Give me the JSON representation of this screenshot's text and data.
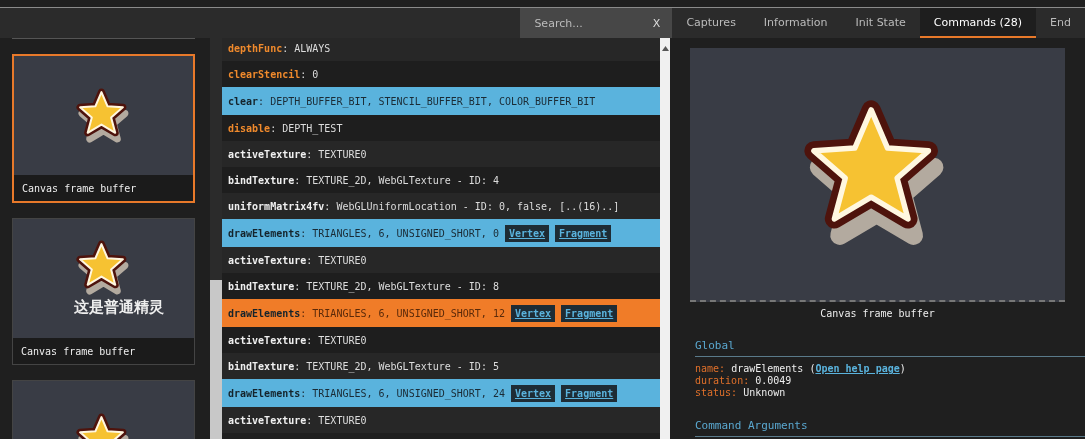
{
  "search": {
    "placeholder": "Search...",
    "clear_label": "X"
  },
  "tabs": [
    {
      "label": "Captures",
      "selected": false
    },
    {
      "label": "Information",
      "selected": false
    },
    {
      "label": "Init State",
      "selected": false
    },
    {
      "label": "Commands (28)",
      "selected": true
    },
    {
      "label": "End",
      "selected": false
    }
  ],
  "thumbnails": [
    {
      "caption": "Canvas frame buffer",
      "selected": true
    },
    {
      "caption": "Canvas frame buffer",
      "overlay_text": "这是普通精灵",
      "selected": false
    },
    {
      "selected": false
    }
  ],
  "commands": [
    {
      "name": "depthFunc",
      "sep": ": ",
      "args": "ALWAYS",
      "kind": "state",
      "selected": false
    },
    {
      "name": "clearStencil",
      "sep": ": ",
      "args": "0",
      "kind": "state",
      "selected": false
    },
    {
      "name": "clear",
      "sep": ": ",
      "args": "DEPTH_BUFFER_BIT, STENCIL_BUFFER_BIT, COLOR_BUFFER_BIT",
      "kind": "draw",
      "selected": false
    },
    {
      "name": "disable",
      "sep": ": ",
      "args": "DEPTH_TEST",
      "kind": "state",
      "selected": false
    },
    {
      "name": "activeTexture",
      "sep": ": ",
      "args": "TEXTURE0",
      "kind": "call",
      "selected": false
    },
    {
      "name": "bindTexture",
      "sep": ": ",
      "args": "TEXTURE_2D, WebGLTexture - ID: 4",
      "kind": "call",
      "selected": false
    },
    {
      "name": "uniformMatrix4fv",
      "sep": ": ",
      "args": "WebGLUniformLocation - ID: 0, false, [..(16)..]",
      "kind": "call",
      "selected": false
    },
    {
      "name": "drawElements",
      "sep": ": ",
      "args": "TRIANGLES, 6, UNSIGNED_SHORT, 0",
      "kind": "draw",
      "selected": false,
      "links": [
        "Vertex",
        "Fragment"
      ]
    },
    {
      "name": "activeTexture",
      "sep": ": ",
      "args": "TEXTURE0",
      "kind": "call",
      "selected": false
    },
    {
      "name": "bindTexture",
      "sep": ": ",
      "args": "TEXTURE_2D, WebGLTexture - ID: 8",
      "kind": "call",
      "selected": false
    },
    {
      "name": "drawElements",
      "sep": ": ",
      "args": "TRIANGLES, 6, UNSIGNED_SHORT, 12",
      "kind": "draw",
      "selected": true,
      "links": [
        "Vertex",
        "Fragment"
      ]
    },
    {
      "name": "activeTexture",
      "sep": ": ",
      "args": "TEXTURE0",
      "kind": "call",
      "selected": false
    },
    {
      "name": "bindTexture",
      "sep": ": ",
      "args": "TEXTURE_2D, WebGLTexture - ID: 5",
      "kind": "call",
      "selected": false
    },
    {
      "name": "drawElements",
      "sep": ": ",
      "args": "TRIANGLES, 6, UNSIGNED_SHORT, 24",
      "kind": "draw",
      "selected": false,
      "links": [
        "Vertex",
        "Fragment"
      ]
    },
    {
      "name": "activeTexture",
      "sep": ": ",
      "args": "TEXTURE0",
      "kind": "call",
      "selected": false
    }
  ],
  "preview": {
    "caption": "Canvas frame buffer"
  },
  "global": {
    "heading": "Global",
    "fields": [
      {
        "key": "name:",
        "value": "drawElements (",
        "link": "Open help page",
        "after": ")"
      },
      {
        "key": "duration:",
        "value": "0.0049"
      },
      {
        "key": "status:",
        "value": "Unknown"
      }
    ]
  },
  "arguments": {
    "heading": "Command Arguments"
  }
}
